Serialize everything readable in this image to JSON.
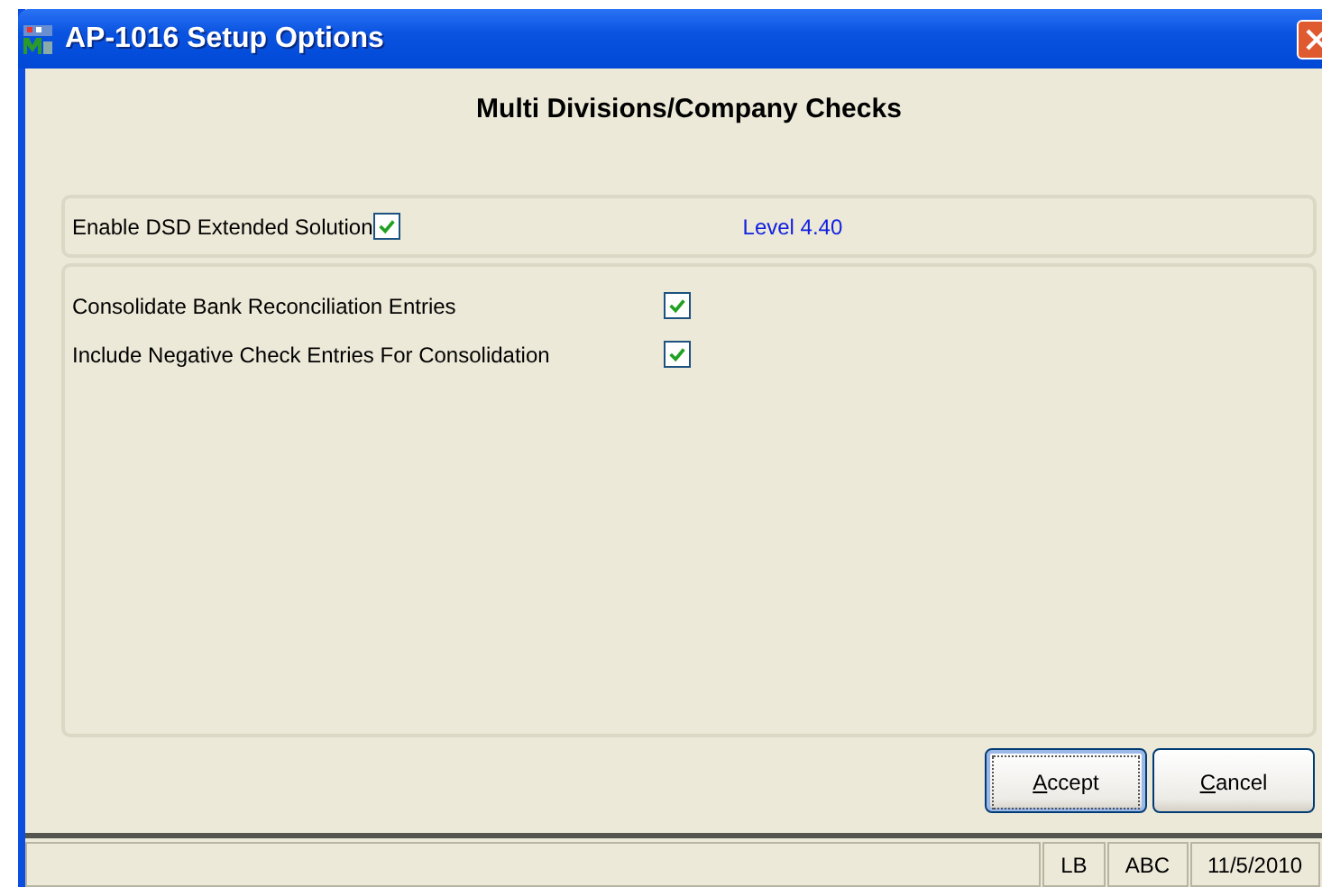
{
  "window": {
    "title": "AP-1016 Setup Options"
  },
  "heading": "Multi Divisions/Company Checks",
  "enable": {
    "label": "Enable DSD Extended Solution",
    "checked": true,
    "level_text": "Level  4.40"
  },
  "options": [
    {
      "label": "Consolidate Bank Reconciliation Entries",
      "checked": true
    },
    {
      "label": "Include Negative Check Entries For Consolidation",
      "checked": true
    }
  ],
  "buttons": [
    {
      "mnemonic": "A",
      "rest": "ccept",
      "default": true
    },
    {
      "mnemonic": "C",
      "rest": "ancel",
      "default": false
    }
  ],
  "status_bar": [
    "LB",
    "ABC",
    "11/5/2010"
  ]
}
